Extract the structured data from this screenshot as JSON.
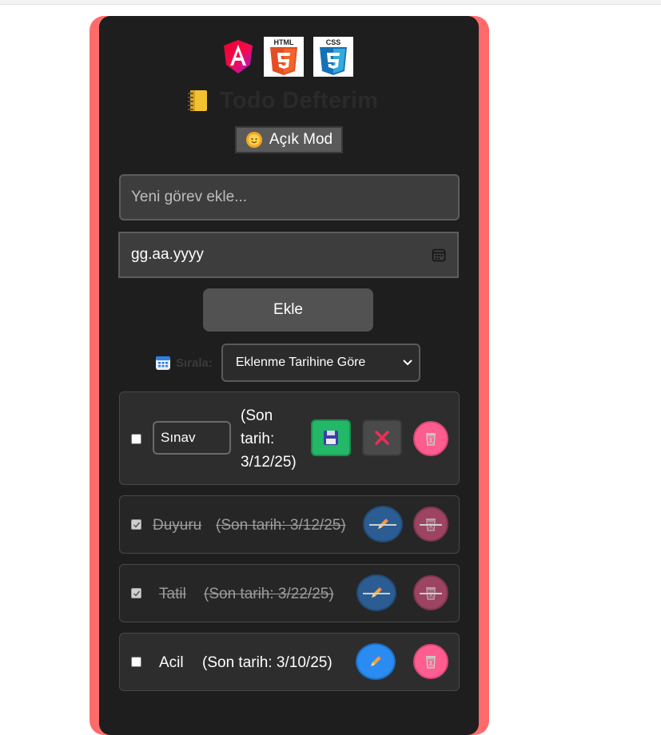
{
  "logos": {
    "angular": "angular-logo",
    "html5": "html5-logo",
    "css3": "css3-logo"
  },
  "header": {
    "title": "Todo Defterim",
    "title_icon": "notebook-icon"
  },
  "theme_toggle": {
    "label": "Açık Mod",
    "icon": "sun-icon"
  },
  "form": {
    "task_placeholder": "Yeni görev ekle...",
    "date_placeholder": "gg.aa.yyyy",
    "add_label": "Ekle"
  },
  "sort": {
    "label": "Sırala:",
    "selected": "Eklenme Tarihine Göre"
  },
  "todos": [
    {
      "text": "Sınav",
      "due": "(Son tarih: 3/12/25)",
      "completed": false,
      "editing": true
    },
    {
      "text": "Duyuru",
      "due": "(Son tarih: 3/12/25)",
      "completed": true,
      "editing": false
    },
    {
      "text": "Tatil",
      "due": "(Son tarih: 3/22/25)",
      "completed": true,
      "editing": false
    },
    {
      "text": "Acil",
      "due": "(Son tarih: 3/10/25)",
      "completed": false,
      "editing": false
    }
  ],
  "colors": {
    "frame": "#ff6b6b",
    "card": "#1e1e1e",
    "save": "#22b867",
    "edit": "#2a8cf0",
    "delete": "#ff5d8f"
  }
}
